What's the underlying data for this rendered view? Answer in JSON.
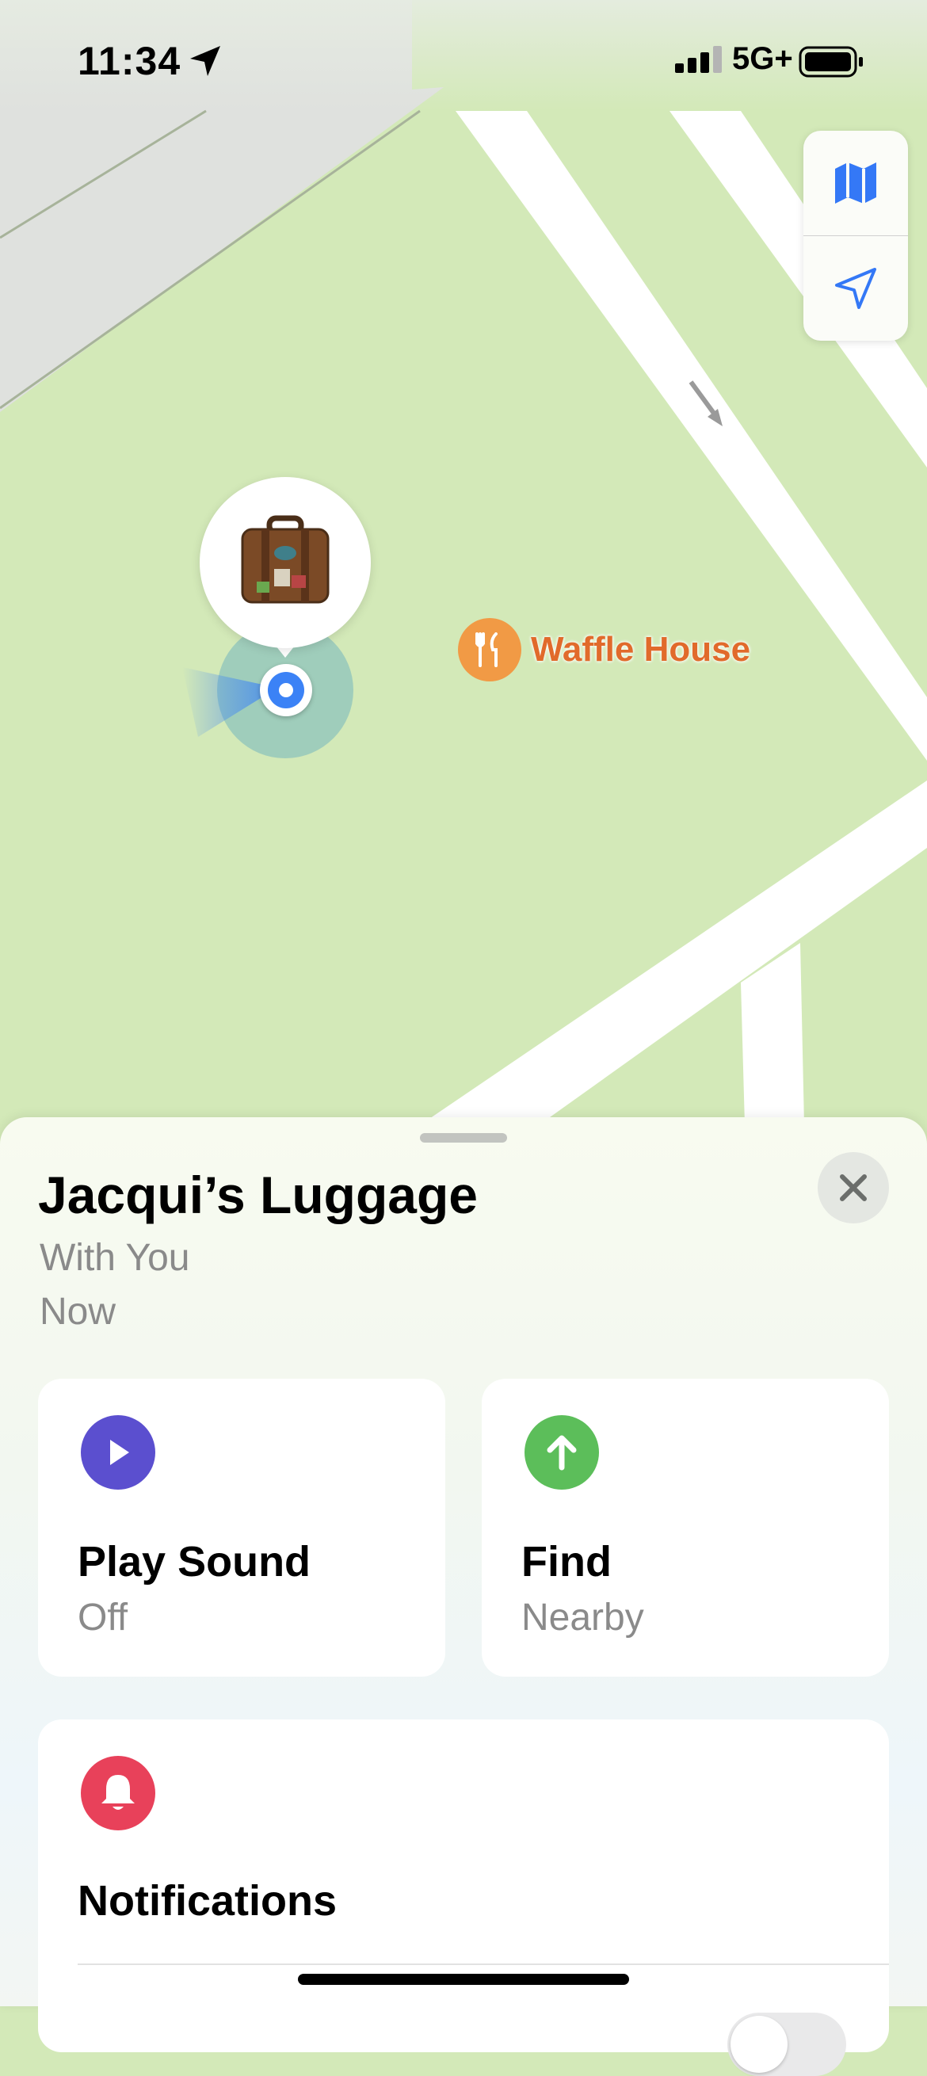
{
  "status_bar": {
    "time": "11:34",
    "network": "5G+"
  },
  "map": {
    "poi_label": "Waffle House",
    "colors": {
      "land": "#d3e9b8",
      "road": "#ffffff",
      "poi": "#f19a45"
    }
  },
  "item": {
    "name": "Jacqui’s Luggage",
    "status": "With You",
    "time": "Now"
  },
  "actions": {
    "play_sound": {
      "title": "Play Sound",
      "subtitle": "Off",
      "color": "#5b4fcf"
    },
    "find": {
      "title": "Find",
      "subtitle": "Nearby",
      "color": "#5cbe5a"
    },
    "notifications": {
      "title": "Notifications",
      "color": "#e8415a"
    }
  }
}
